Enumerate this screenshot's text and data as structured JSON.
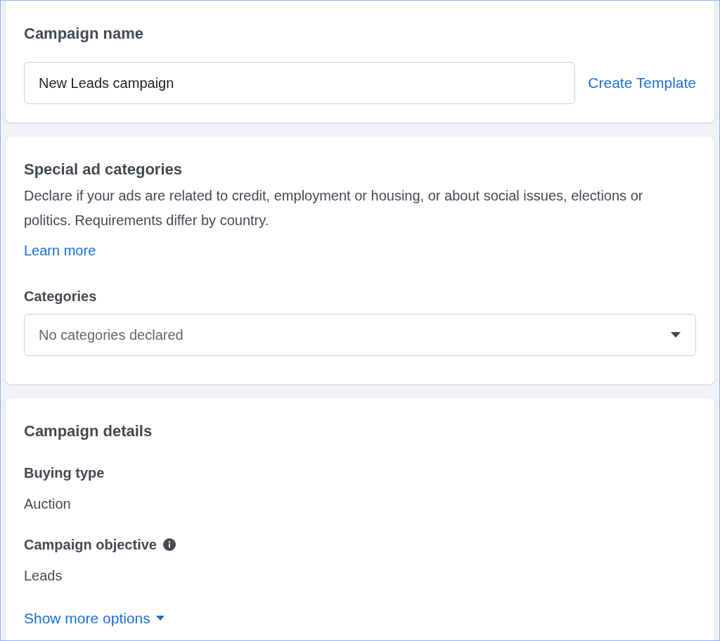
{
  "campaign_name": {
    "title": "Campaign name",
    "value": "New Leads campaign",
    "link": "Create Template"
  },
  "special_ad_categories": {
    "title": "Special ad categories",
    "description": "Declare if your ads are related to credit, employment or housing, or about social issues, elections or politics. Requirements differ by country.",
    "link": "Learn more",
    "categories_label": "Categories",
    "categories_placeholder": "No categories declared"
  },
  "campaign_details": {
    "title": "Campaign details",
    "fields": [
      {
        "label": "Buying type",
        "value": "Auction",
        "info": false
      },
      {
        "label": "Campaign objective",
        "value": "Leads",
        "info": true
      }
    ],
    "more_link": "Show more options"
  }
}
